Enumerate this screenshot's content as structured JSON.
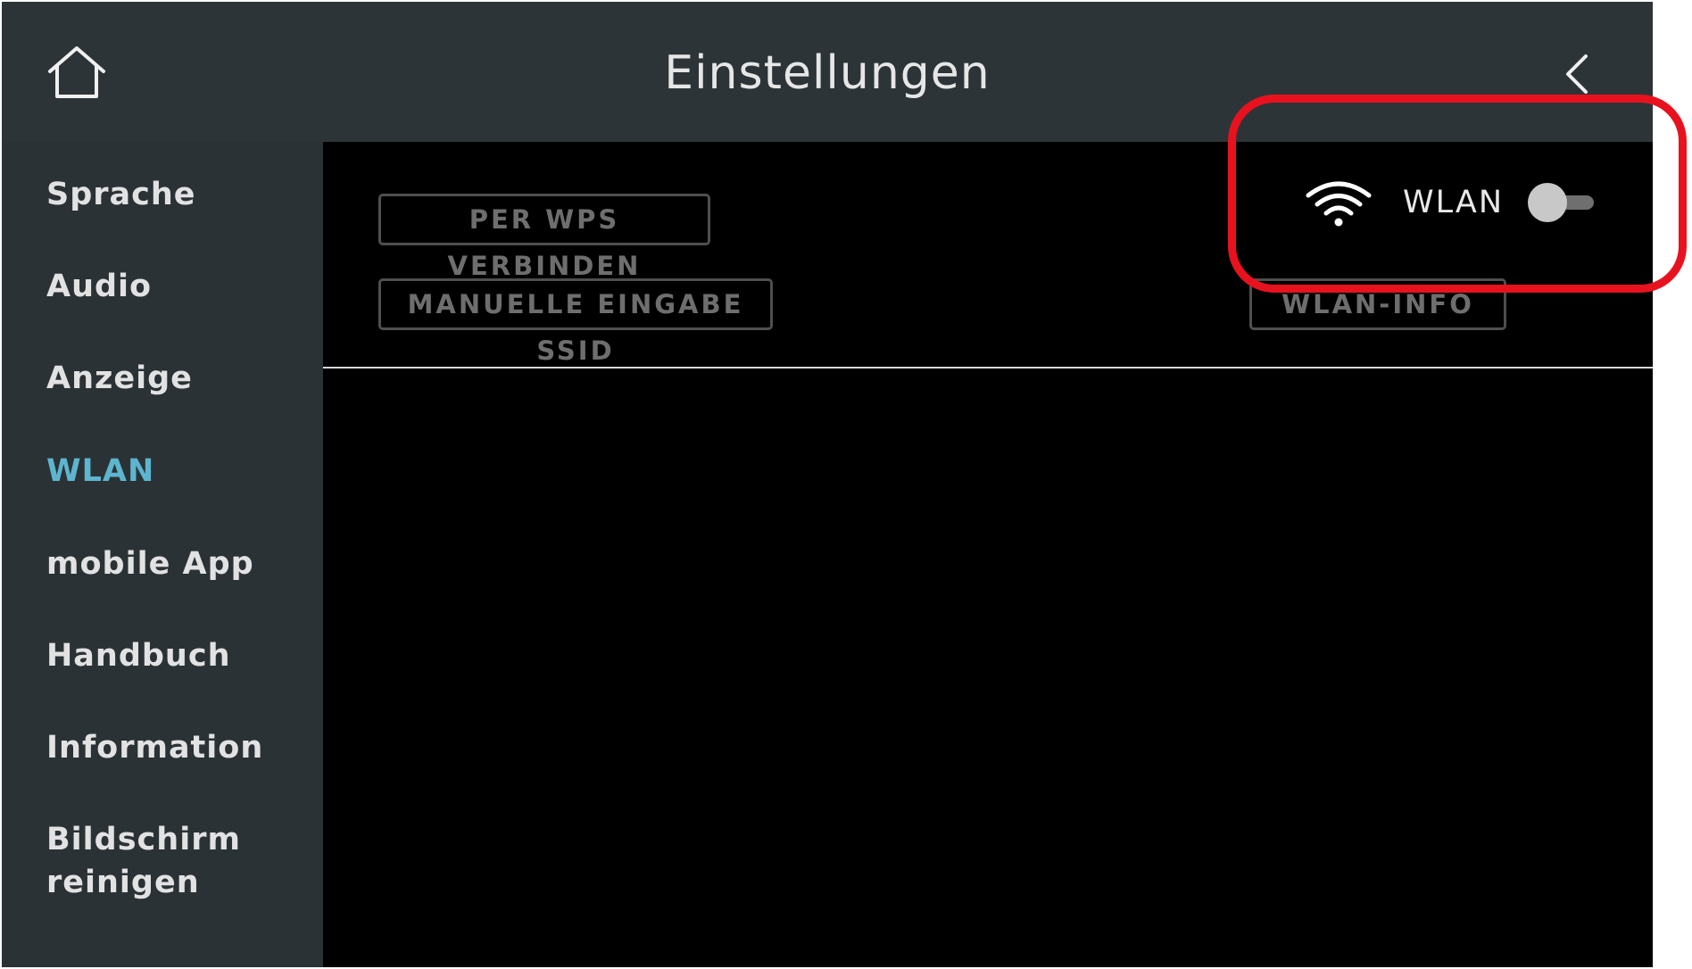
{
  "header": {
    "title": "Einstellungen",
    "home_icon": "home-icon",
    "back_icon": "chevron-left-icon"
  },
  "sidebar": {
    "items": [
      {
        "label": "Sprache",
        "active": false
      },
      {
        "label": "Audio",
        "active": false
      },
      {
        "label": "Anzeige",
        "active": false
      },
      {
        "label": "WLAN",
        "active": true
      },
      {
        "label": "mobile App",
        "active": false
      },
      {
        "label": "Handbuch",
        "active": false
      },
      {
        "label": "Information",
        "active": false
      },
      {
        "label": "Bildschirm\nreinigen",
        "active": false
      }
    ]
  },
  "main": {
    "wps_button": "PER WPS VERBINDEN",
    "manual_ssid_button": "MANUELLE EINGABE SSID",
    "wlan_info_button": "WLAN-INFO",
    "wlan_label": "WLAN",
    "wlan_toggle": "off"
  },
  "colors": {
    "header_bg": "#2d3437",
    "sidebar_bg": "#2b3235",
    "active_item": "#5db5cf",
    "highlight": "#e8121f"
  }
}
